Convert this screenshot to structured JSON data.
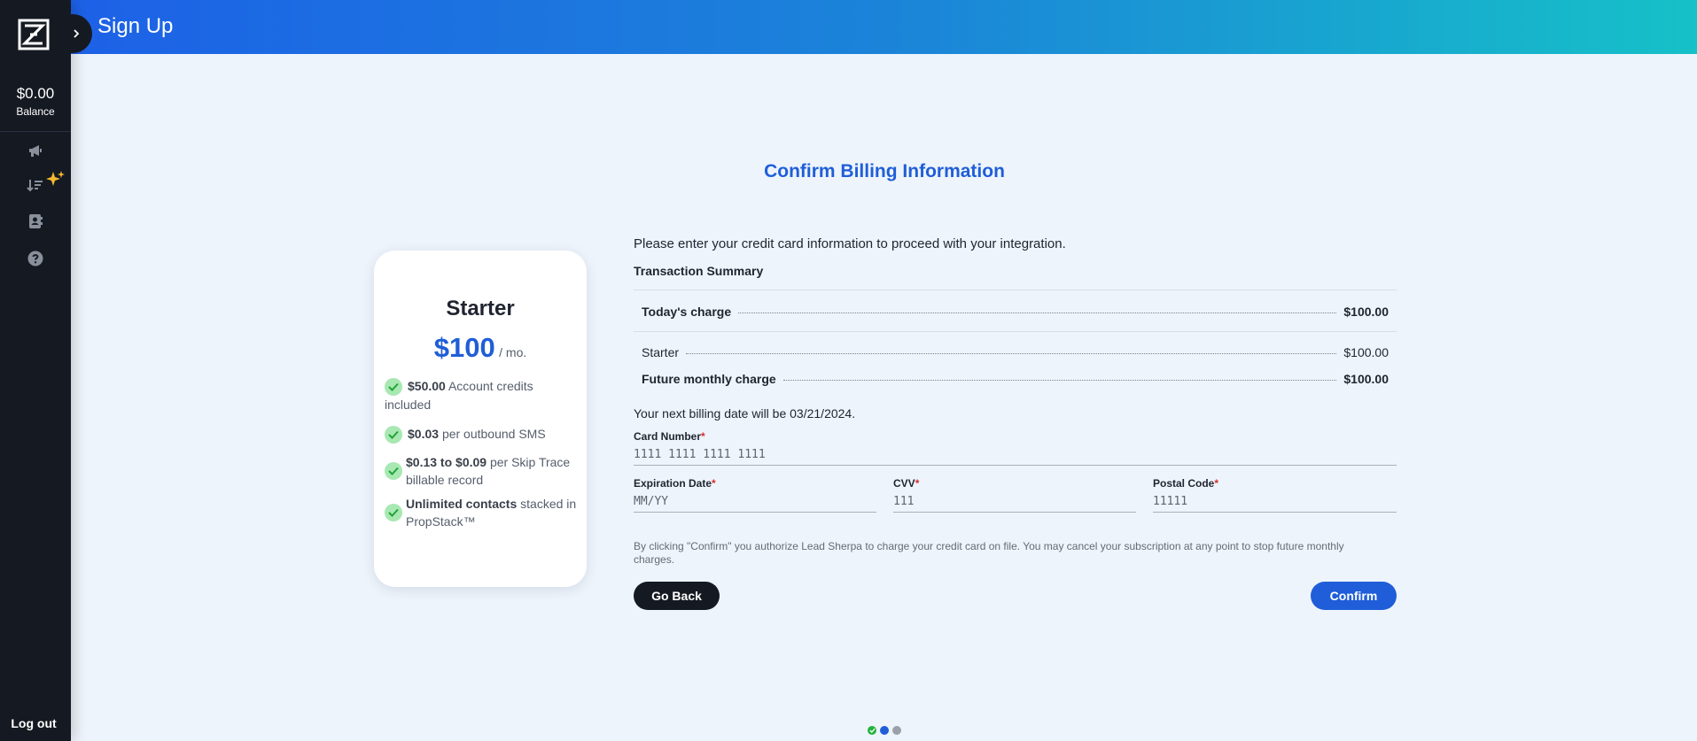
{
  "header": {
    "title": "Sign Up"
  },
  "sidebar": {
    "balance_amount": "$0.00",
    "balance_label": "Balance",
    "nav_icons": [
      "megaphone-icon",
      "sort-sparkle-icon",
      "contacts-book-icon",
      "help-circle-icon"
    ],
    "logout_label": "Log out"
  },
  "page": {
    "title": "Confirm Billing Information"
  },
  "plan": {
    "name": "Starter",
    "price": "$100",
    "period": "/ mo.",
    "features": [
      {
        "bold": "$50.00",
        "text": "Account credits included"
      },
      {
        "bold": "$0.03",
        "text": "per outbound SMS"
      },
      {
        "bold": "$0.13 to $0.09",
        "text": "per Skip Trace billable record"
      },
      {
        "bold": "Unlimited contacts",
        "text": "stacked in PropStack™"
      }
    ]
  },
  "form": {
    "intro": "Please enter your credit card information to proceed with your integration.",
    "summary_title": "Transaction Summary",
    "lines": [
      {
        "label": "Today's charge",
        "amount": "$100.00"
      },
      {
        "label": "Starter",
        "amount": "$100.00"
      },
      {
        "label": "Future monthly charge",
        "amount": "$100.00"
      }
    ],
    "next_billing": "Your next billing date will be 03/21/2024.",
    "card_number": {
      "label": "Card Number",
      "required": "*",
      "placeholder": "1111 1111 1111 1111"
    },
    "expiration": {
      "label": "Expiration Date",
      "required": "*",
      "placeholder": "MM/YY"
    },
    "cvv": {
      "label": "CVV",
      "required": "*",
      "placeholder": "111"
    },
    "postal": {
      "label": "Postal Code",
      "required": "*",
      "placeholder": "11111"
    },
    "disclaimer": "By clicking \"Confirm\" you authorize Lead Sherpa to charge your credit card on file. You may cancel your subscription at any point to stop future monthly charges.",
    "back_label": "Go Back",
    "confirm_label": "Confirm"
  },
  "steps": {
    "current": 2,
    "total": 3,
    "colors": {
      "done": "#22b33c",
      "current": "#1f5ed8",
      "pending": "#9aa1ab"
    }
  },
  "colors": {
    "accent": "#1f5ed8",
    "sidebar": "#151a22",
    "sparkle": "#f5b82e"
  }
}
